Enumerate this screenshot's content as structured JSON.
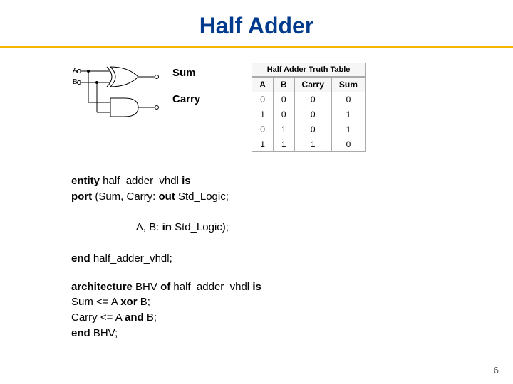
{
  "title": "Half Adder",
  "diagram": {
    "input_a": "A",
    "input_b": "B",
    "sum_label": "Sum",
    "carry_label": "Carry"
  },
  "truth_table": {
    "title": "Half Adder Truth Table",
    "headers": [
      "A",
      "B",
      "Carry",
      "Sum"
    ],
    "rows": [
      [
        "0",
        "0",
        "0",
        "0"
      ],
      [
        "1",
        "0",
        "0",
        "1"
      ],
      [
        "0",
        "1",
        "0",
        "1"
      ],
      [
        "1",
        "1",
        "1",
        "0"
      ]
    ]
  },
  "code": {
    "l1a": "entity",
    "l1b": " half_adder_vhdl ",
    "l1c": "is",
    "l2a": " port ",
    "l2b": "(Sum, Carry: ",
    "l2c": "out",
    "l2d": " Std_Logic;",
    "l3a": "                A, B: ",
    "l3b": "in",
    "l3c": " Std_Logic);",
    "l4a": "end",
    "l4b": " half_adder_vhdl;",
    "l5a": "architecture ",
    "l5b": "BHV ",
    "l5c": "of ",
    "l5d": "half_adder_vhdl ",
    "l5e": "is",
    "l6a": "Sum <= A ",
    "l6b": "xor",
    "l6c": " B;",
    "l7a": "Carry <= A ",
    "l7b": "and",
    "l7c": " B;",
    "l8a": "end ",
    "l8b": "BHV;"
  },
  "page_number": "6",
  "chart_data": {
    "type": "table",
    "title": "Half Adder Truth Table",
    "columns": [
      "A",
      "B",
      "Carry",
      "Sum"
    ],
    "rows": [
      {
        "A": 0,
        "B": 0,
        "Carry": 0,
        "Sum": 0
      },
      {
        "A": 1,
        "B": 0,
        "Carry": 0,
        "Sum": 1
      },
      {
        "A": 0,
        "B": 1,
        "Carry": 0,
        "Sum": 1
      },
      {
        "A": 1,
        "B": 1,
        "Carry": 1,
        "Sum": 0
      }
    ]
  }
}
